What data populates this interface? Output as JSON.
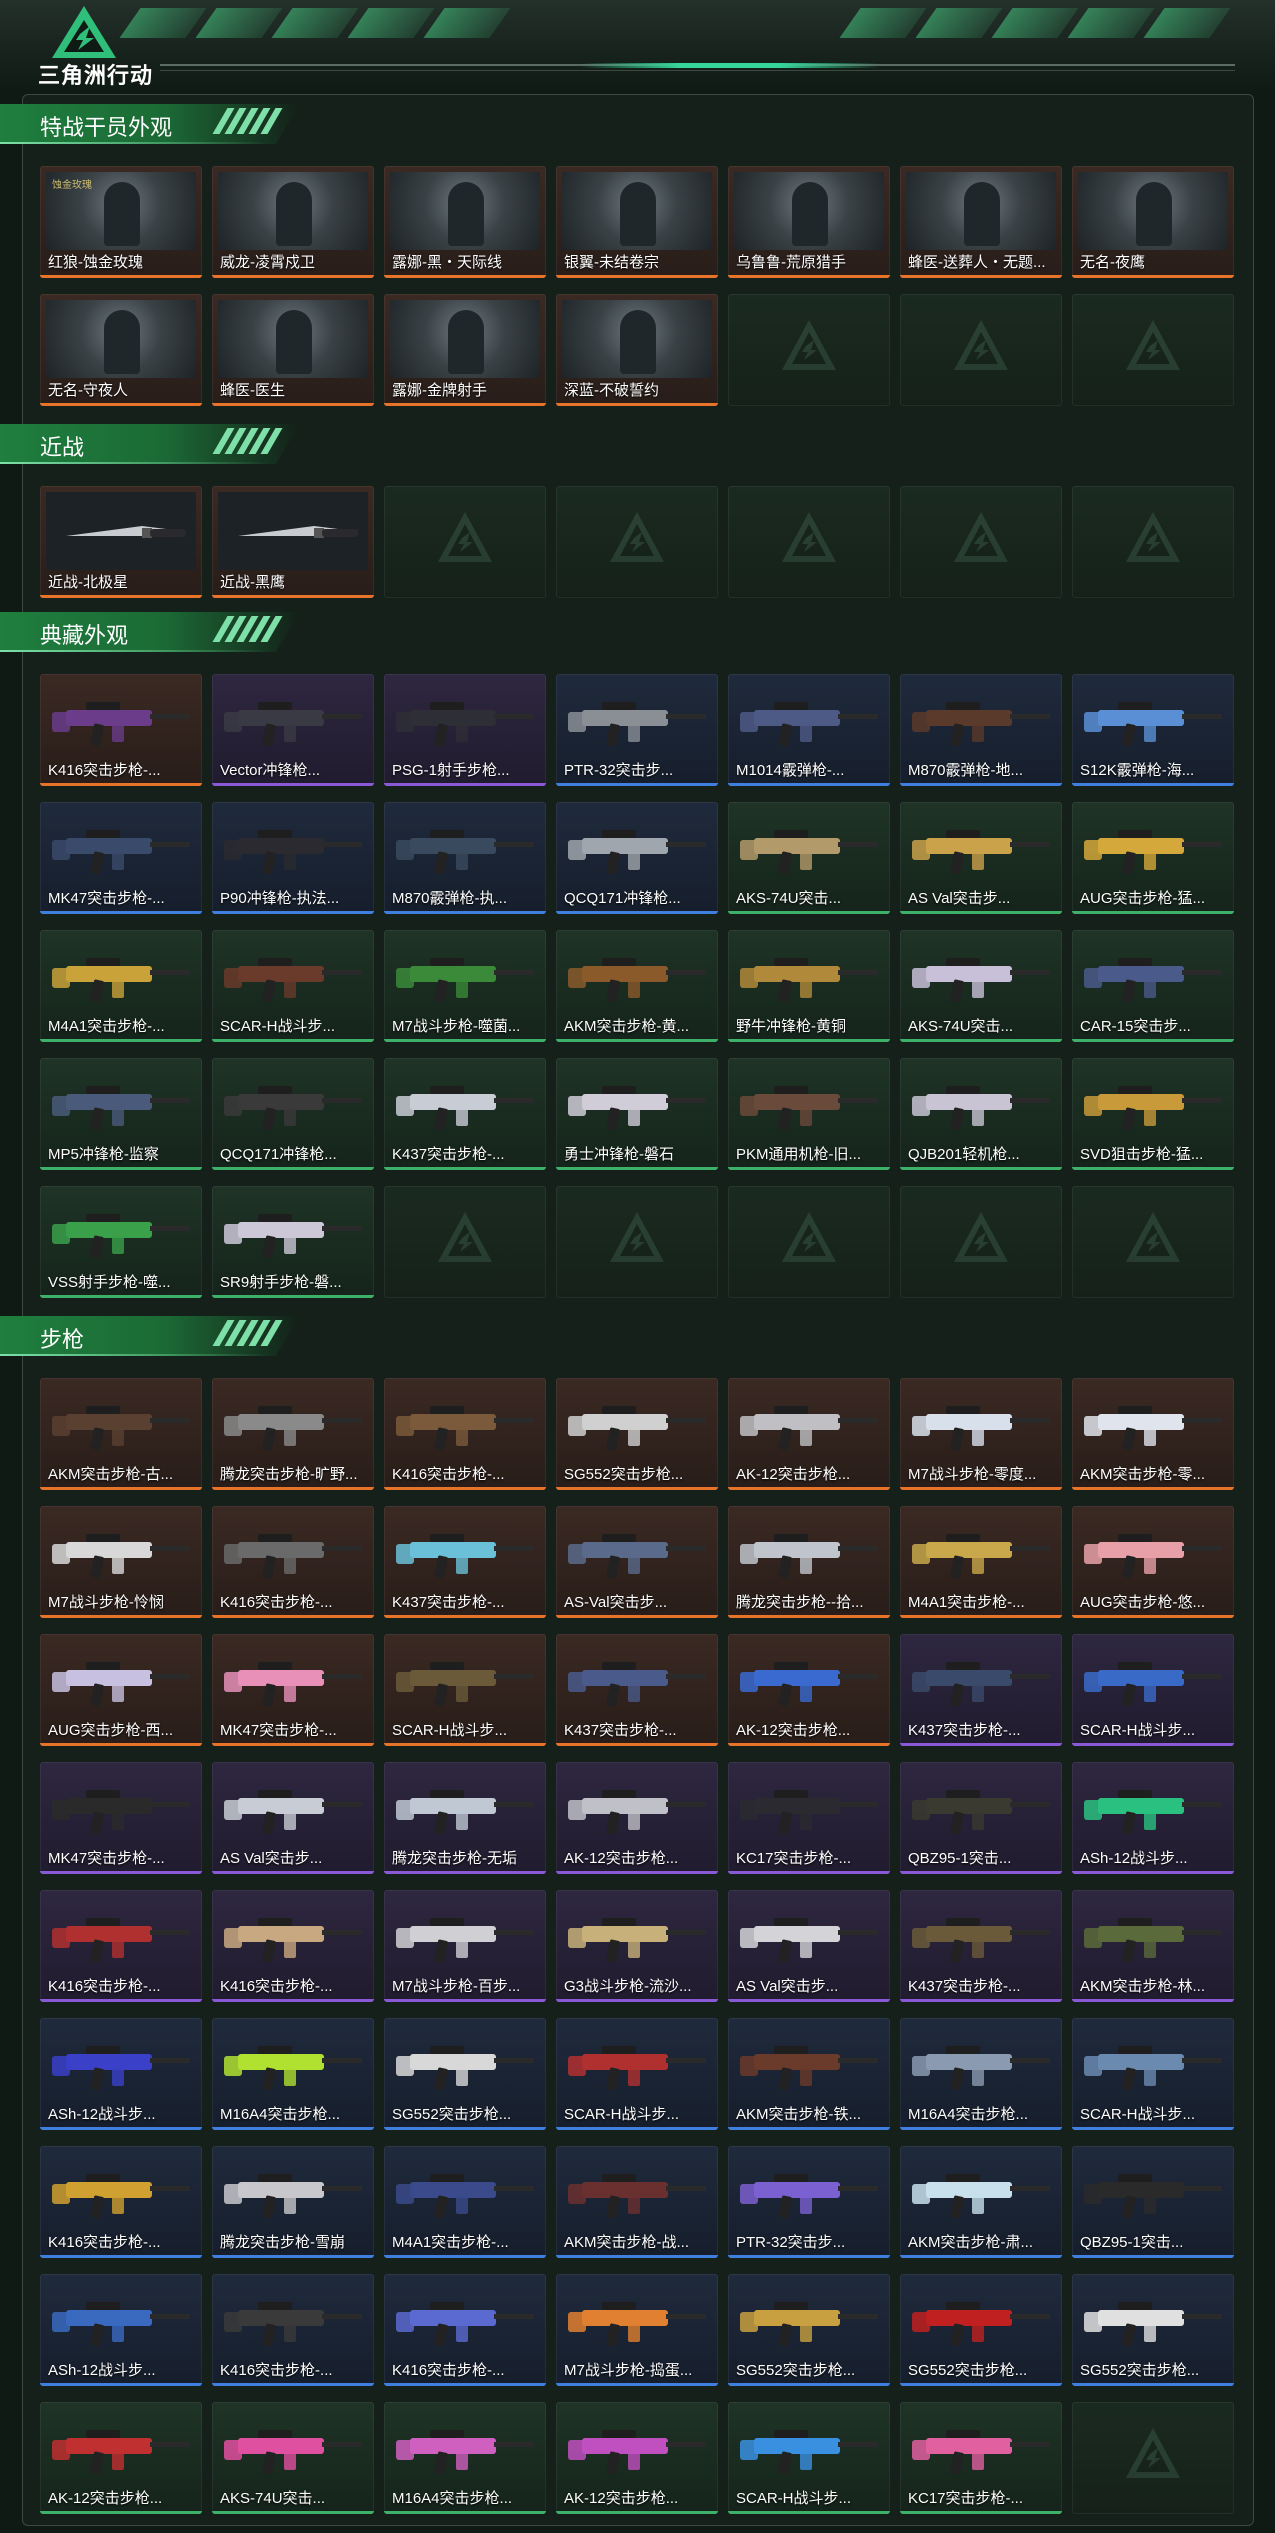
{
  "header": {
    "brand": "三角洲行动"
  },
  "sections": [
    {
      "title": "特战干员外观",
      "items": [
        {
          "label": "红狼-蚀金玫瑰",
          "rarity": "orange",
          "kind": "portrait",
          "tag": "蚀金玫瑰"
        },
        {
          "label": "威龙-凌霄戍卫",
          "rarity": "orange",
          "kind": "portrait",
          "tag": ""
        },
        {
          "label": "露娜-黑・天际线",
          "rarity": "orange",
          "kind": "portrait",
          "tag": ""
        },
        {
          "label": "银翼-未结卷宗",
          "rarity": "orange",
          "kind": "portrait",
          "tag": ""
        },
        {
          "label": "乌鲁鲁-荒原猎手",
          "rarity": "orange",
          "kind": "portrait",
          "tag": ""
        },
        {
          "label": "蜂医-送葬人・无题...",
          "rarity": "orange",
          "kind": "portrait",
          "tag": ""
        },
        {
          "label": "无名-夜鹰",
          "rarity": "orange",
          "kind": "portrait",
          "tag": ""
        },
        {
          "label": "无名-守夜人",
          "rarity": "orange",
          "kind": "portrait",
          "tag": ""
        },
        {
          "label": "蜂医-医生",
          "rarity": "orange",
          "kind": "portrait",
          "tag": ""
        },
        {
          "label": "露娜-金牌射手",
          "rarity": "orange",
          "kind": "portrait",
          "tag": ""
        },
        {
          "label": "深蓝-不破誓约",
          "rarity": "orange",
          "kind": "portrait",
          "tag": ""
        },
        {
          "empty": true
        },
        {
          "empty": true
        },
        {
          "empty": true
        }
      ]
    },
    {
      "title": "近战",
      "items": [
        {
          "label": "近战-北极星",
          "rarity": "orange",
          "kind": "knife"
        },
        {
          "label": "近战-黑鹰",
          "rarity": "orange",
          "kind": "knife"
        },
        {
          "empty": true
        },
        {
          "empty": true
        },
        {
          "empty": true
        },
        {
          "empty": true
        },
        {
          "empty": true
        }
      ]
    },
    {
      "title": "典藏外观",
      "items": [
        {
          "label": "K416突击步枪-...",
          "rarity": "orange",
          "kind": "gun",
          "color": "#6a3c8a"
        },
        {
          "label": "Vector冲锋枪...",
          "rarity": "purple",
          "kind": "gun",
          "color": "#3a3a44"
        },
        {
          "label": "PSG-1射手步枪...",
          "rarity": "purple",
          "kind": "gun",
          "color": "#2e2e36"
        },
        {
          "label": "PTR-32突击步...",
          "rarity": "blue",
          "kind": "gun",
          "color": "#8a8f96"
        },
        {
          "label": "M1014霰弹枪-...",
          "rarity": "blue",
          "kind": "gun",
          "color": "#4d5a86"
        },
        {
          "label": "M870霰弹枪-地...",
          "rarity": "blue",
          "kind": "gun",
          "color": "#5a3a2a"
        },
        {
          "label": "S12K霰弹枪-海...",
          "rarity": "blue",
          "kind": "gun",
          "color": "#5a8fd6"
        },
        {
          "label": "MK47突击步枪-...",
          "rarity": "blue",
          "kind": "gun",
          "color": "#3a4a6a"
        },
        {
          "label": "P90冲锋枪-执法...",
          "rarity": "blue",
          "kind": "gun",
          "color": "#2a2a30"
        },
        {
          "label": "M870霰弹枪-执...",
          "rarity": "blue",
          "kind": "gun",
          "color": "#3a4a5e"
        },
        {
          "label": "QCQ171冲锋枪...",
          "rarity": "blue",
          "kind": "gun",
          "color": "#a0a6ad"
        },
        {
          "label": "AKS-74U突击...",
          "rarity": "green",
          "kind": "gun",
          "color": "#b39a6a"
        },
        {
          "label": "AS Val突击步...",
          "rarity": "green",
          "kind": "gun",
          "color": "#c9a24a"
        },
        {
          "label": "AUG突击步枪-猛...",
          "rarity": "green",
          "kind": "gun",
          "color": "#d4a83a"
        },
        {
          "label": "M4A1突击步枪-...",
          "rarity": "green",
          "kind": "gun",
          "color": "#c9a23a"
        },
        {
          "label": "SCAR-H战斗步...",
          "rarity": "green",
          "kind": "gun",
          "color": "#6a3a2a"
        },
        {
          "label": "M7战斗步枪-噬菌...",
          "rarity": "green",
          "kind": "gun",
          "color": "#3a8a3a"
        },
        {
          "label": "AKM突击步枪-黄...",
          "rarity": "green",
          "kind": "gun",
          "color": "#8a5a2a"
        },
        {
          "label": "野牛冲锋枪-黄铜",
          "rarity": "green",
          "kind": "gun",
          "color": "#b08a3a"
        },
        {
          "label": "AKS-74U突击...",
          "rarity": "green",
          "kind": "gun",
          "color": "#c8c0d8"
        },
        {
          "label": "CAR-15突击步...",
          "rarity": "green",
          "kind": "gun",
          "color": "#4a5a8a"
        },
        {
          "label": "MP5冲锋枪-监察",
          "rarity": "green",
          "kind": "gun",
          "color": "#4a5a7a"
        },
        {
          "label": "QCQ171冲锋枪...",
          "rarity": "green",
          "kind": "gun",
          "color": "#3a3a3a"
        },
        {
          "label": "K437突击步枪-...",
          "rarity": "green",
          "kind": "gun",
          "color": "#c8ccd4"
        },
        {
          "label": "勇士冲锋枪-磐石",
          "rarity": "green",
          "kind": "gun",
          "color": "#d0ccd8"
        },
        {
          "label": "PKM通用机枪-旧...",
          "rarity": "green",
          "kind": "gun",
          "color": "#6a4a3a"
        },
        {
          "label": "QJB201轻机枪...",
          "rarity": "green",
          "kind": "gun",
          "color": "#c8c4d4"
        },
        {
          "label": "SVD狙击步枪-猛...",
          "rarity": "green",
          "kind": "gun",
          "color": "#c89a3a"
        },
        {
          "label": "VSS射手步枪-噬...",
          "rarity": "green",
          "kind": "gun",
          "color": "#3aa04a"
        },
        {
          "label": "SR9射手步枪-磐...",
          "rarity": "green",
          "kind": "gun",
          "color": "#ccc8d8"
        },
        {
          "empty": true
        },
        {
          "empty": true
        },
        {
          "empty": true
        },
        {
          "empty": true
        },
        {
          "empty": true
        }
      ]
    },
    {
      "title": "步枪",
      "items": [
        {
          "label": "AKM突击步枪-古...",
          "rarity": "orange",
          "kind": "gun",
          "color": "#5a4030"
        },
        {
          "label": "腾龙突击步枪-旷野...",
          "rarity": "orange",
          "kind": "gun",
          "color": "#8a8a8a"
        },
        {
          "label": "K416突击步枪-...",
          "rarity": "orange",
          "kind": "gun",
          "color": "#7a5a3a"
        },
        {
          "label": "SG552突击步枪...",
          "rarity": "orange",
          "kind": "gun",
          "color": "#d0d0d0"
        },
        {
          "label": "AK-12突击步枪...",
          "rarity": "orange",
          "kind": "gun",
          "color": "#c0c0c4"
        },
        {
          "label": "M7战斗步枪-零度...",
          "rarity": "orange",
          "kind": "gun",
          "color": "#d8e0ec"
        },
        {
          "label": "AKM突击步枪-零...",
          "rarity": "orange",
          "kind": "gun",
          "color": "#e0e4ec"
        },
        {
          "label": "M7战斗步枪-怜悯",
          "rarity": "orange",
          "kind": "gun",
          "color": "#d8d8d8"
        },
        {
          "label": "K416突击步枪-...",
          "rarity": "orange",
          "kind": "gun",
          "color": "#6a6a6a"
        },
        {
          "label": "K437突击步枪-...",
          "rarity": "orange",
          "kind": "gun",
          "color": "#6ac0d8"
        },
        {
          "label": "AS-Val突击步...",
          "rarity": "orange",
          "kind": "gun",
          "color": "#5a6a8a"
        },
        {
          "label": "腾龙突击步枪--拾...",
          "rarity": "orange",
          "kind": "gun",
          "color": "#c0c4cc"
        },
        {
          "label": "M4A1突击步枪-...",
          "rarity": "orange",
          "kind": "gun",
          "color": "#c8a84a"
        },
        {
          "label": "AUG突击步枪-悠...",
          "rarity": "orange",
          "kind": "gun",
          "color": "#e8a0a8"
        },
        {
          "label": "AUG突击步枪-西...",
          "rarity": "orange",
          "kind": "gun",
          "color": "#c8c0e0"
        },
        {
          "label": "MK47突击步枪-...",
          "rarity": "orange",
          "kind": "gun",
          "color": "#e890b8"
        },
        {
          "label": "SCAR-H战斗步...",
          "rarity": "orange",
          "kind": "gun",
          "color": "#6a5a3a"
        },
        {
          "label": "K437突击步枪-...",
          "rarity": "orange",
          "kind": "gun",
          "color": "#4a5a8a"
        },
        {
          "label": "AK-12突击步枪...",
          "rarity": "orange",
          "kind": "gun",
          "color": "#3a6ad0"
        },
        {
          "label": "K437突击步枪-...",
          "rarity": "purple",
          "kind": "gun",
          "color": "#3a4a6a"
        },
        {
          "label": "SCAR-H战斗步...",
          "rarity": "purple",
          "kind": "gun",
          "color": "#3a6ac8"
        },
        {
          "label": "MK47突击步枪-...",
          "rarity": "purple",
          "kind": "gun",
          "color": "#2a2a2a"
        },
        {
          "label": "AS Val突击步...",
          "rarity": "purple",
          "kind": "gun",
          "color": "#c8ccd4"
        },
        {
          "label": "腾龙突击步枪-无垢",
          "rarity": "purple",
          "kind": "gun",
          "color": "#c0c8d4"
        },
        {
          "label": "AK-12突击步枪...",
          "rarity": "purple",
          "kind": "gun",
          "color": "#c0c0c8"
        },
        {
          "label": "KC17突击步枪-...",
          "rarity": "purple",
          "kind": "gun",
          "color": "#2a2a30"
        },
        {
          "label": "QBZ95-1突击...",
          "rarity": "purple",
          "kind": "gun",
          "color": "#3a3a30"
        },
        {
          "label": "ASh-12战斗步...",
          "rarity": "purple",
          "kind": "gun",
          "color": "#2ac080"
        },
        {
          "label": "K416突击步枪-...",
          "rarity": "purple",
          "kind": "gun",
          "color": "#b03030"
        },
        {
          "label": "K416突击步枪-...",
          "rarity": "purple",
          "kind": "gun",
          "color": "#c8a880"
        },
        {
          "label": "M7战斗步枪-百步...",
          "rarity": "purple",
          "kind": "gun",
          "color": "#d0d0d4"
        },
        {
          "label": "G3战斗步枪-流沙...",
          "rarity": "purple",
          "kind": "gun",
          "color": "#c8b07a"
        },
        {
          "label": "AS Val突击步...",
          "rarity": "purple",
          "kind": "gun",
          "color": "#d4d4d8"
        },
        {
          "label": "K437突击步枪-...",
          "rarity": "purple",
          "kind": "gun",
          "color": "#6a5a3a"
        },
        {
          "label": "AKM突击步枪-林...",
          "rarity": "purple",
          "kind": "gun",
          "color": "#5a6a3a"
        },
        {
          "label": "ASh-12战斗步...",
          "rarity": "blue",
          "kind": "gun",
          "color": "#3a40c8"
        },
        {
          "label": "M16A4突击步枪...",
          "rarity": "blue",
          "kind": "gun",
          "color": "#b0e030"
        },
        {
          "label": "SG552突击步枪...",
          "rarity": "blue",
          "kind": "gun",
          "color": "#d8d8d8"
        },
        {
          "label": "SCAR-H战斗步...",
          "rarity": "blue",
          "kind": "gun",
          "color": "#b03030"
        },
        {
          "label": "AKM突击步枪-铁...",
          "rarity": "blue",
          "kind": "gun",
          "color": "#6a3a2a"
        },
        {
          "label": "M16A4突击步枪...",
          "rarity": "blue",
          "kind": "gun",
          "color": "#8a9ab0"
        },
        {
          "label": "SCAR-H战斗步...",
          "rarity": "blue",
          "kind": "gun",
          "color": "#6a8ab0"
        },
        {
          "label": "K416突击步枪-...",
          "rarity": "blue",
          "kind": "gun",
          "color": "#d0a030"
        },
        {
          "label": "腾龙突击步枪-雪崩",
          "rarity": "blue",
          "kind": "gun",
          "color": "#c8c8cc"
        },
        {
          "label": "M4A1突击步枪-...",
          "rarity": "blue",
          "kind": "gun",
          "color": "#3a4a8a"
        },
        {
          "label": "AKM突击步枪-战...",
          "rarity": "blue",
          "kind": "gun",
          "color": "#6a3030"
        },
        {
          "label": "PTR-32突击步...",
          "rarity": "blue",
          "kind": "gun",
          "color": "#7a60d0"
        },
        {
          "label": "AKM突击步枪-肃...",
          "rarity": "blue",
          "kind": "gun",
          "color": "#c8e0ec"
        },
        {
          "label": "QBZ95-1突击...",
          "rarity": "blue",
          "kind": "gun",
          "color": "#2a2a2a"
        },
        {
          "label": "ASh-12战斗步...",
          "rarity": "blue",
          "kind": "gun",
          "color": "#3a6ac0"
        },
        {
          "label": "K416突击步枪-...",
          "rarity": "blue",
          "kind": "gun",
          "color": "#3a3a3a"
        },
        {
          "label": "K416突击步枪-...",
          "rarity": "blue",
          "kind": "gun",
          "color": "#5a6ad0"
        },
        {
          "label": "M7战斗步枪-捣蛋...",
          "rarity": "blue",
          "kind": "gun",
          "color": "#e08030"
        },
        {
          "label": "SG552突击步枪...",
          "rarity": "blue",
          "kind": "gun",
          "color": "#c8a040"
        },
        {
          "label": "SG552突击步枪...",
          "rarity": "blue",
          "kind": "gun",
          "color": "#c02020"
        },
        {
          "label": "SG552突击步枪...",
          "rarity": "blue",
          "kind": "gun",
          "color": "#e0e0e0"
        },
        {
          "label": "AK-12突击步枪...",
          "rarity": "green",
          "kind": "gun",
          "color": "#c03030"
        },
        {
          "label": "AKS-74U突击...",
          "rarity": "green",
          "kind": "gun",
          "color": "#e050a0"
        },
        {
          "label": "M16A4突击步枪...",
          "rarity": "green",
          "kind": "gun",
          "color": "#d060c0"
        },
        {
          "label": "AK-12突击步枪...",
          "rarity": "green",
          "kind": "gun",
          "color": "#c050c0"
        },
        {
          "label": "SCAR-H战斗步...",
          "rarity": "green",
          "kind": "gun",
          "color": "#3a90e0"
        },
        {
          "label": "KC17突击步枪-...",
          "rarity": "green",
          "kind": "gun",
          "color": "#e060a0"
        },
        {
          "empty": true
        }
      ]
    }
  ]
}
